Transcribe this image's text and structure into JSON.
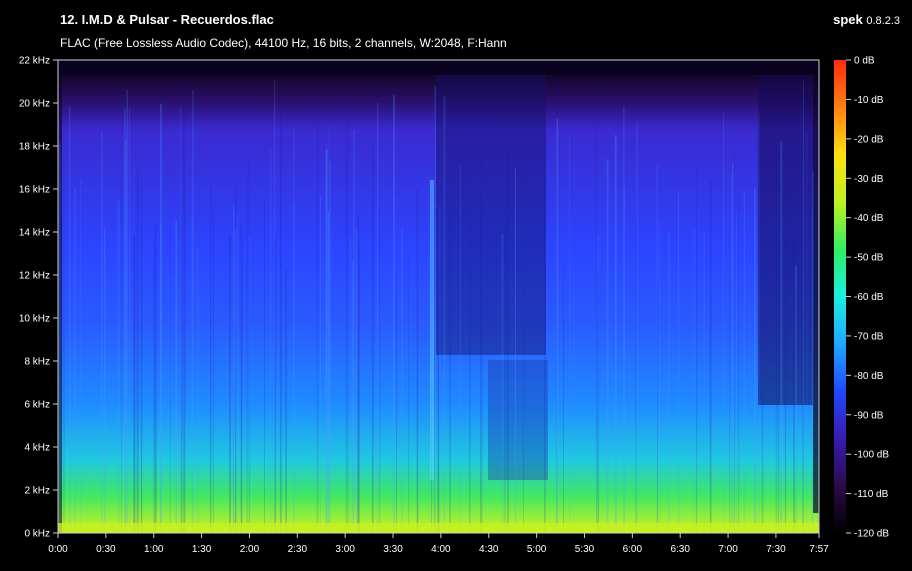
{
  "header": {
    "title": "12. I.M.D & Pulsar - Recuerdos.flac",
    "subtitle": "FLAC (Free Lossless Audio Codec), 44100 Hz, 16 bits, 2 channels, W:2048, F:Hann",
    "app_name": "spek",
    "app_version": "0.8.2.3"
  },
  "chart_data": {
    "type": "heatmap",
    "x_ticks": [
      "0:00",
      "0:30",
      "1:00",
      "1:30",
      "2:00",
      "2:30",
      "3:00",
      "3:30",
      "4:00",
      "4:30",
      "5:00",
      "5:30",
      "6:00",
      "6:30",
      "7:00",
      "7:30",
      "7:57"
    ],
    "y_ticks": [
      "0 kHz",
      "2 kHz",
      "4 kHz",
      "6 kHz",
      "8 kHz",
      "10 kHz",
      "12 kHz",
      "14 kHz",
      "16 kHz",
      "18 kHz",
      "20 kHz",
      "22 kHz"
    ],
    "xlim": [
      0,
      477
    ],
    "ylim": [
      0,
      22
    ],
    "colorbar": {
      "ticks": [
        "0 dB",
        "-10 dB",
        "-20 dB",
        "-30 dB",
        "-40 dB",
        "-50 dB",
        "-60 dB",
        "-70 dB",
        "-80 dB",
        "-90 dB",
        "-100 dB",
        "-110 dB",
        "-120 dB"
      ],
      "range": [
        -120,
        0
      ],
      "colors": [
        "#000000",
        "#2a0b4a",
        "#3a1bb0",
        "#1f49ff",
        "#20a8ff",
        "#18f0e0",
        "#30f060",
        "#c0f020",
        "#ffe010",
        "#ff8010",
        "#ff2a10"
      ]
    }
  }
}
